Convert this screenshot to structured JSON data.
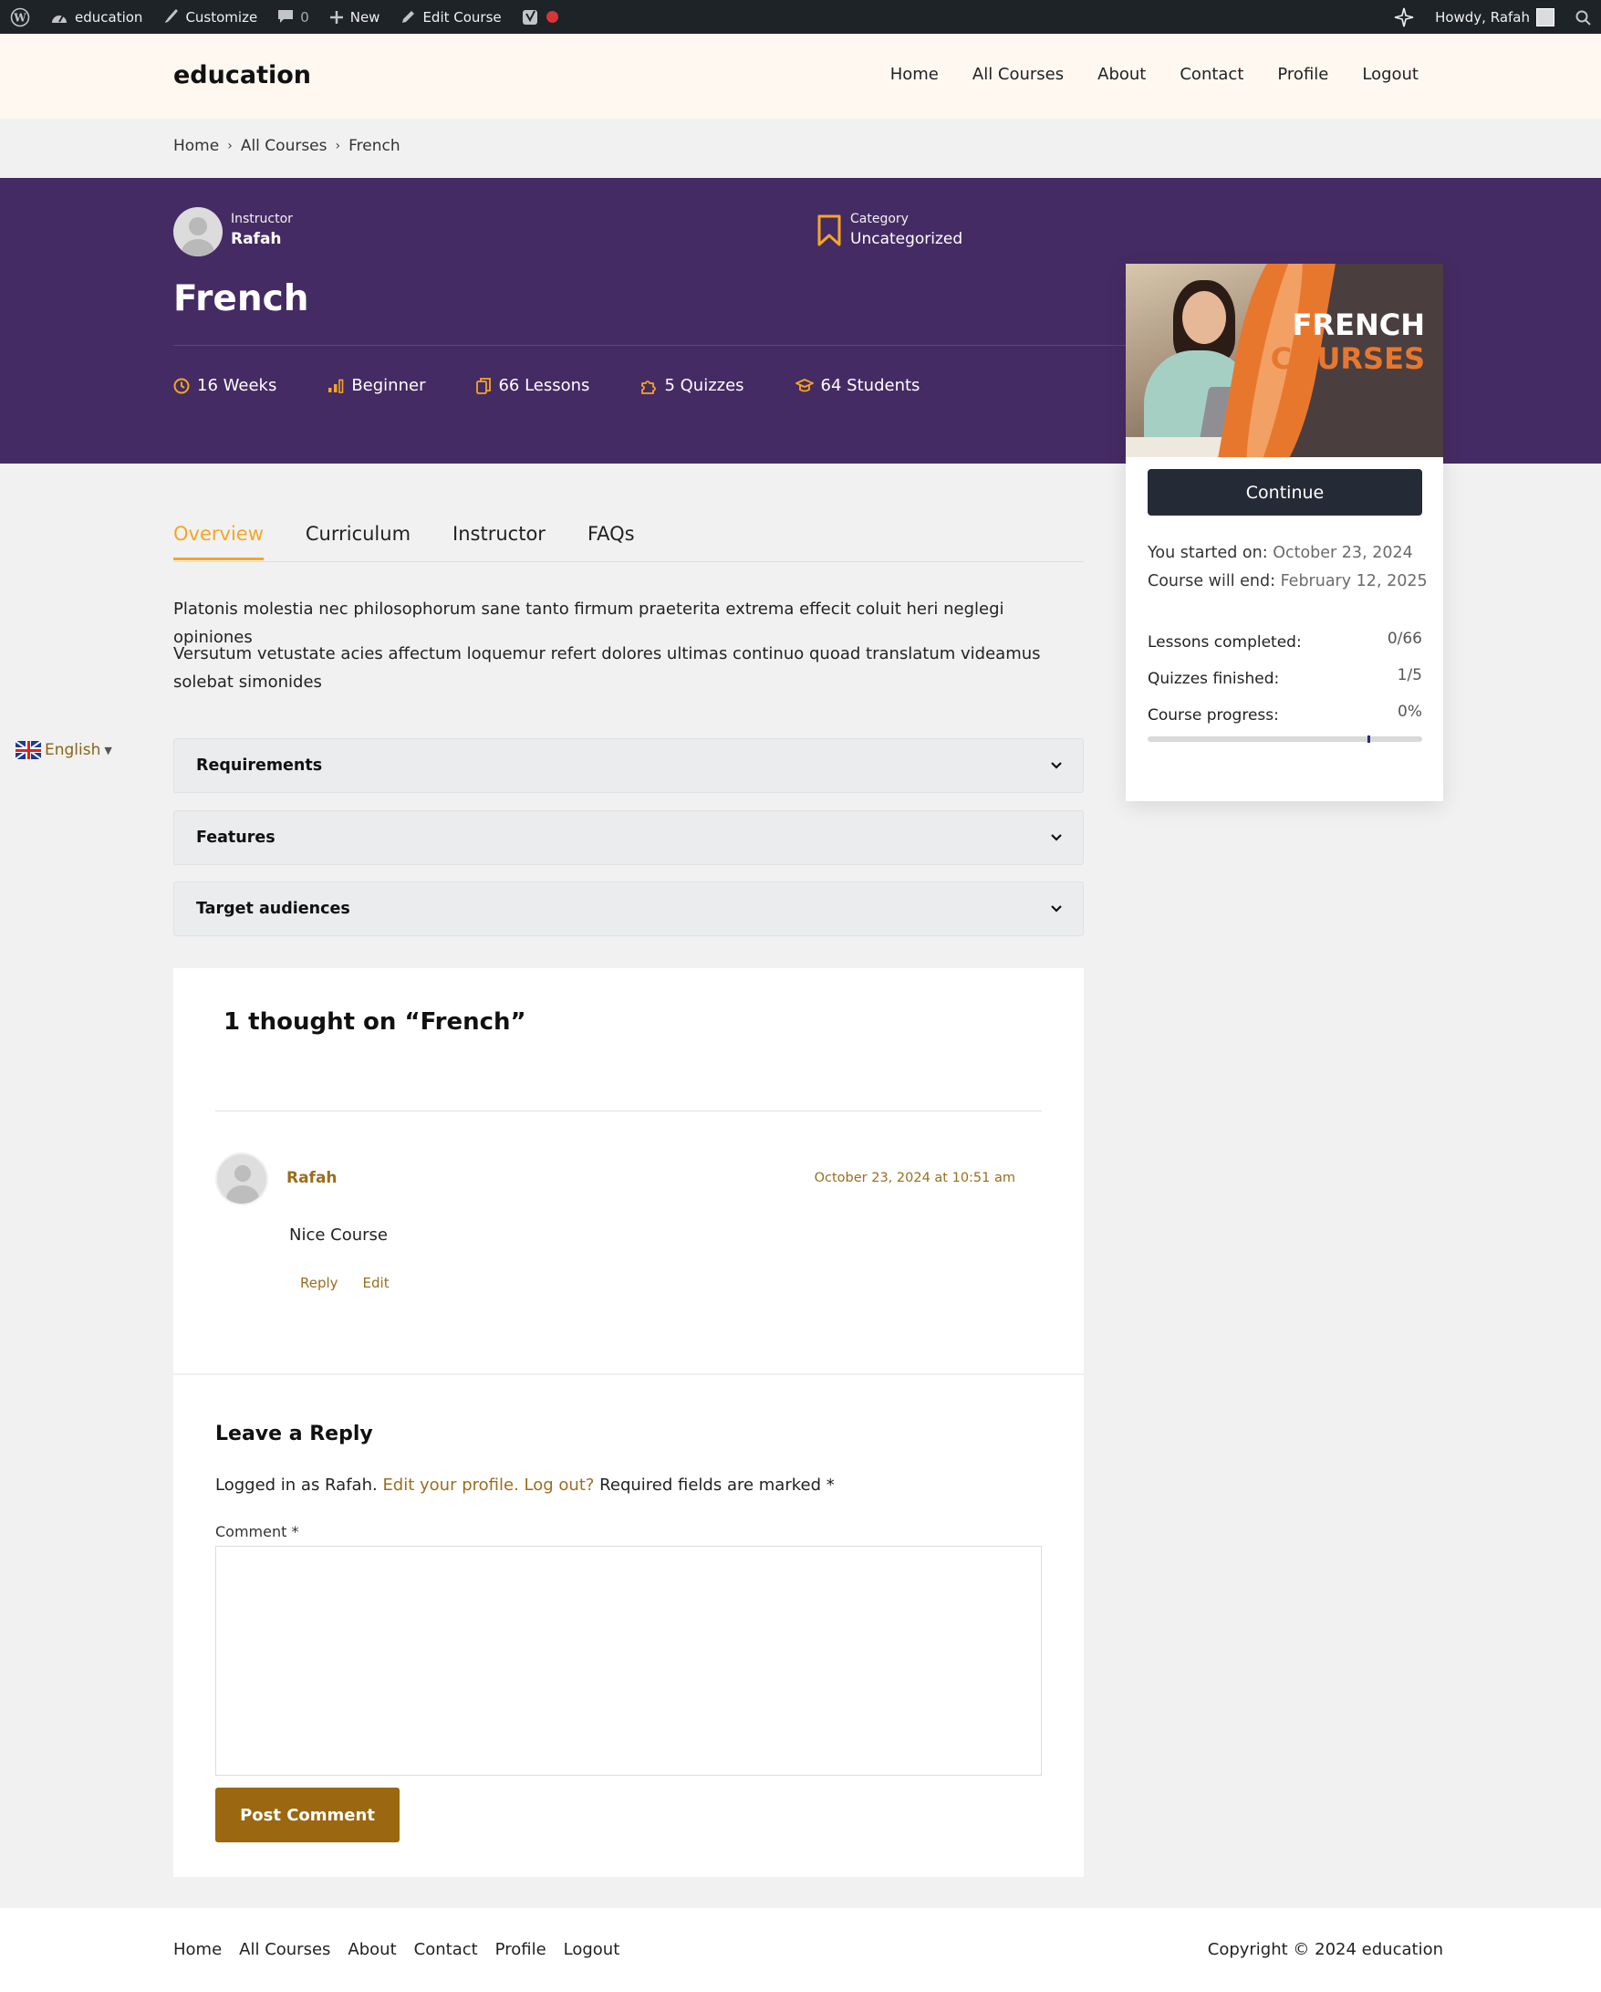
{
  "admin_bar": {
    "site_name": "education",
    "customize": "Customize",
    "comments_count": "0",
    "new": "New",
    "edit_course": "Edit Course",
    "howdy": "Howdy, Rafah"
  },
  "header": {
    "logo": "education",
    "nav": [
      "Home",
      "All Courses",
      "About",
      "Contact",
      "Profile",
      "Logout"
    ]
  },
  "breadcrumb": [
    "Home",
    "All Courses",
    "French"
  ],
  "hero": {
    "instructor_label": "Instructor",
    "instructor_name": "Rafah",
    "category_label": "Category",
    "category_value": "Uncategorized",
    "title": "French",
    "stats": {
      "duration": "16 Weeks",
      "level": "Beginner",
      "lessons": "66 Lessons",
      "quizzes": "5 Quizzes",
      "students": "64 Students"
    }
  },
  "course_card": {
    "image_text_line1": "FRENCH",
    "image_text_line2": "COURSES",
    "continue_label": "Continue",
    "started_label": "You started on:",
    "started_date": "October 23, 2024",
    "end_label": "Course will end:",
    "end_date": "February 12, 2025",
    "lessons_label": "Lessons completed:",
    "lessons_value": "0/66",
    "quizzes_label": "Quizzes finished:",
    "quizzes_value": "1/5",
    "progress_label": "Course progress:",
    "progress_value": "0%"
  },
  "tabs": [
    "Overview",
    "Curriculum",
    "Instructor",
    "FAQs"
  ],
  "overview": {
    "paragraph1": "Platonis molestia nec philosophorum sane tanto firmum praeterita extrema effecit coluit heri neglegi opiniones",
    "paragraph2": "Versutum vetustate acies affectum loquemur refert dolores ultimas continuo quoad translatum videamus solebat simonides"
  },
  "language": "English",
  "accordion": [
    "Requirements",
    "Features",
    "Target audiences"
  ],
  "comments": {
    "title": "1 thought on “French”",
    "author": "Rafah",
    "date": "October 23, 2024 at 10:51 am",
    "text": "Nice Course",
    "reply": "Reply",
    "edit": "Edit"
  },
  "reply_form": {
    "title": "Leave a Reply",
    "logged_in": "Logged in as Rafah.",
    "edit_profile": "Edit your profile.",
    "log_out": "Log out?",
    "required": "Required fields are marked *",
    "comment_label": "Comment *",
    "submit": "Post Comment"
  },
  "footer": {
    "nav": [
      "Home",
      "All Courses",
      "About",
      "Contact",
      "Profile",
      "Logout"
    ],
    "copyright": "Copyright © 2024 education"
  },
  "colors": {
    "accent": "#f5a623",
    "hero_bg": "#452b63",
    "brand_brown": "#9b6710"
  }
}
